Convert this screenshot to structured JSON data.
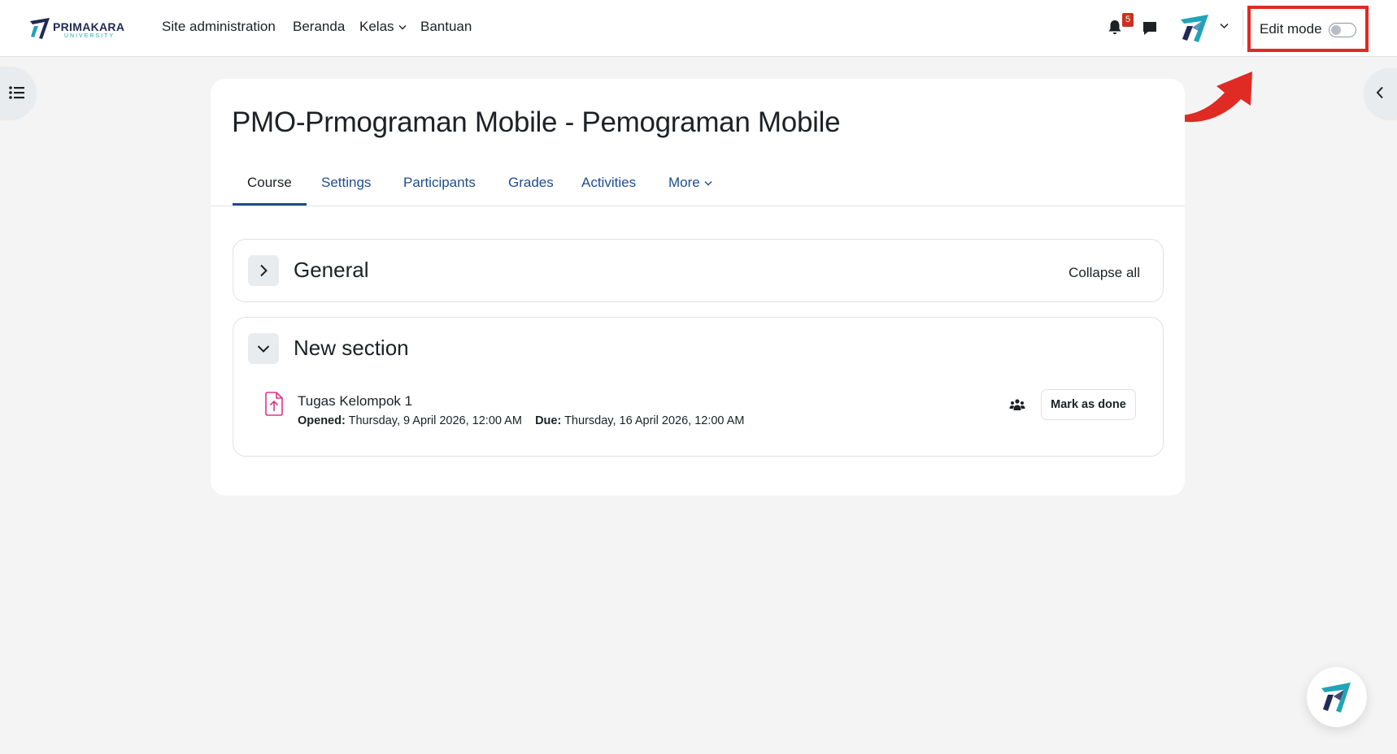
{
  "brand": {
    "name": "PRIMAKARA",
    "sub": "UNIVERSITY"
  },
  "nav": {
    "items": [
      {
        "label": "Site administration"
      },
      {
        "label": "Beranda"
      },
      {
        "label": "Kelas"
      },
      {
        "label": "Bantuan"
      }
    ],
    "notification_count": "5",
    "edit_mode_label": "Edit mode",
    "edit_mode_on": false
  },
  "course": {
    "title": "PMO-Prmograman Mobile - Pemograman Mobile",
    "tabs": [
      {
        "label": "Course",
        "active": true
      },
      {
        "label": "Settings"
      },
      {
        "label": "Participants"
      },
      {
        "label": "Grades"
      },
      {
        "label": "Activities"
      },
      {
        "label": "More"
      }
    ]
  },
  "sections": {
    "general": {
      "title": "General",
      "collapse_all": "Collapse all"
    },
    "new_section": {
      "title": "New section",
      "activity": {
        "name": "Tugas Kelompok 1",
        "opened_label": "Opened:",
        "opened_value": "Thursday, 9 April 2026, 12:00 AM",
        "due_label": "Due:",
        "due_value": "Thursday, 16 April 2026, 12:00 AM",
        "mark_done": "Mark as done"
      }
    }
  },
  "colors": {
    "accent": "#1f4c8f",
    "highlight": "#e02a24",
    "badge": "#ca3120"
  },
  "icons": [
    "course-index-icon",
    "bell-icon",
    "chat-icon",
    "chevron-left-icon",
    "assignment-upload-icon",
    "group-icon"
  ]
}
